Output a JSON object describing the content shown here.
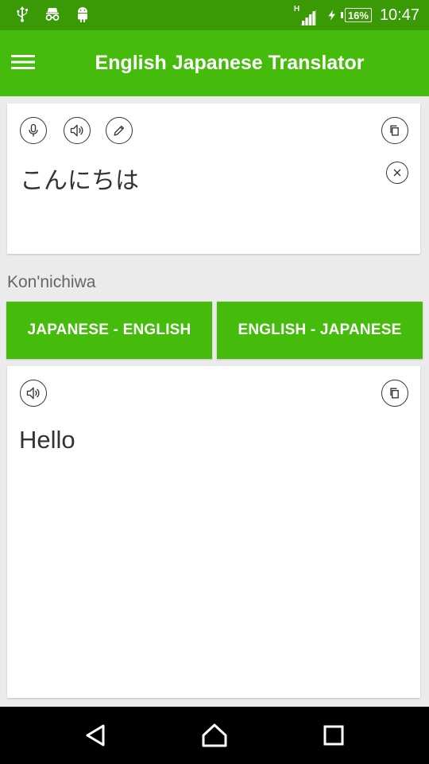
{
  "status_bar": {
    "network": "H",
    "battery": "16%",
    "time": "10:47",
    "icons": [
      "usb-icon",
      "incognito-icon",
      "android-icon",
      "signal-icon",
      "charging-icon",
      "battery-icon"
    ]
  },
  "app_bar": {
    "title": "English Japanese Translator",
    "menu_icon": "hamburger-menu-icon"
  },
  "source_card": {
    "text": "こんにちは",
    "icons": [
      "microphone-icon",
      "speaker-icon",
      "pencil-icon",
      "copy-icon",
      "clear-icon"
    ]
  },
  "transliteration": "Kon'nichiwa",
  "language_buttons": {
    "japanese_english": "JAPANESE - ENGLISH",
    "english_japanese": "ENGLISH - JAPANESE"
  },
  "target_card": {
    "text": "Hello",
    "icons": [
      "speaker-icon",
      "copy-icon"
    ]
  },
  "colors": {
    "status_bar": "#3a9a05",
    "app_bar": "#45bb0c",
    "button": "#45bb0c",
    "background": "#ebebeb"
  },
  "nav_bar": {
    "icons": [
      "back-icon",
      "home-icon",
      "recents-icon"
    ]
  }
}
